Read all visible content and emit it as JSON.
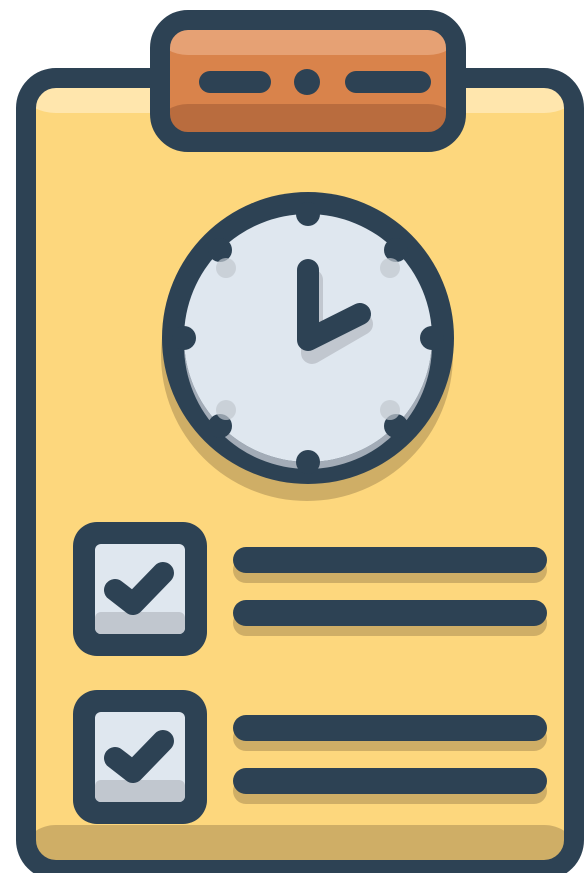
{
  "icon": {
    "semantic": "clipboard-schedule-checklist-icon",
    "parts": [
      "clipboard-clip",
      "clock",
      "checkbox",
      "text-line"
    ]
  },
  "colors": {
    "outline": "#2d4254",
    "board": "#fdd77d",
    "board_highlight": "#ffe7b0",
    "board_shadow": "#cfae66",
    "clip_main": "#d9834b",
    "clip_light": "#e6a174",
    "clip_dark": "#b96c3e",
    "clock_face": "#dfe7ef",
    "clock_shadow": "#c1c7cf",
    "checkbox_face": "#dfe7ef",
    "checkbox_shadow": "#c1c7cf"
  },
  "checklist": {
    "items": [
      {
        "checked": true
      },
      {
        "checked": true
      }
    ]
  }
}
